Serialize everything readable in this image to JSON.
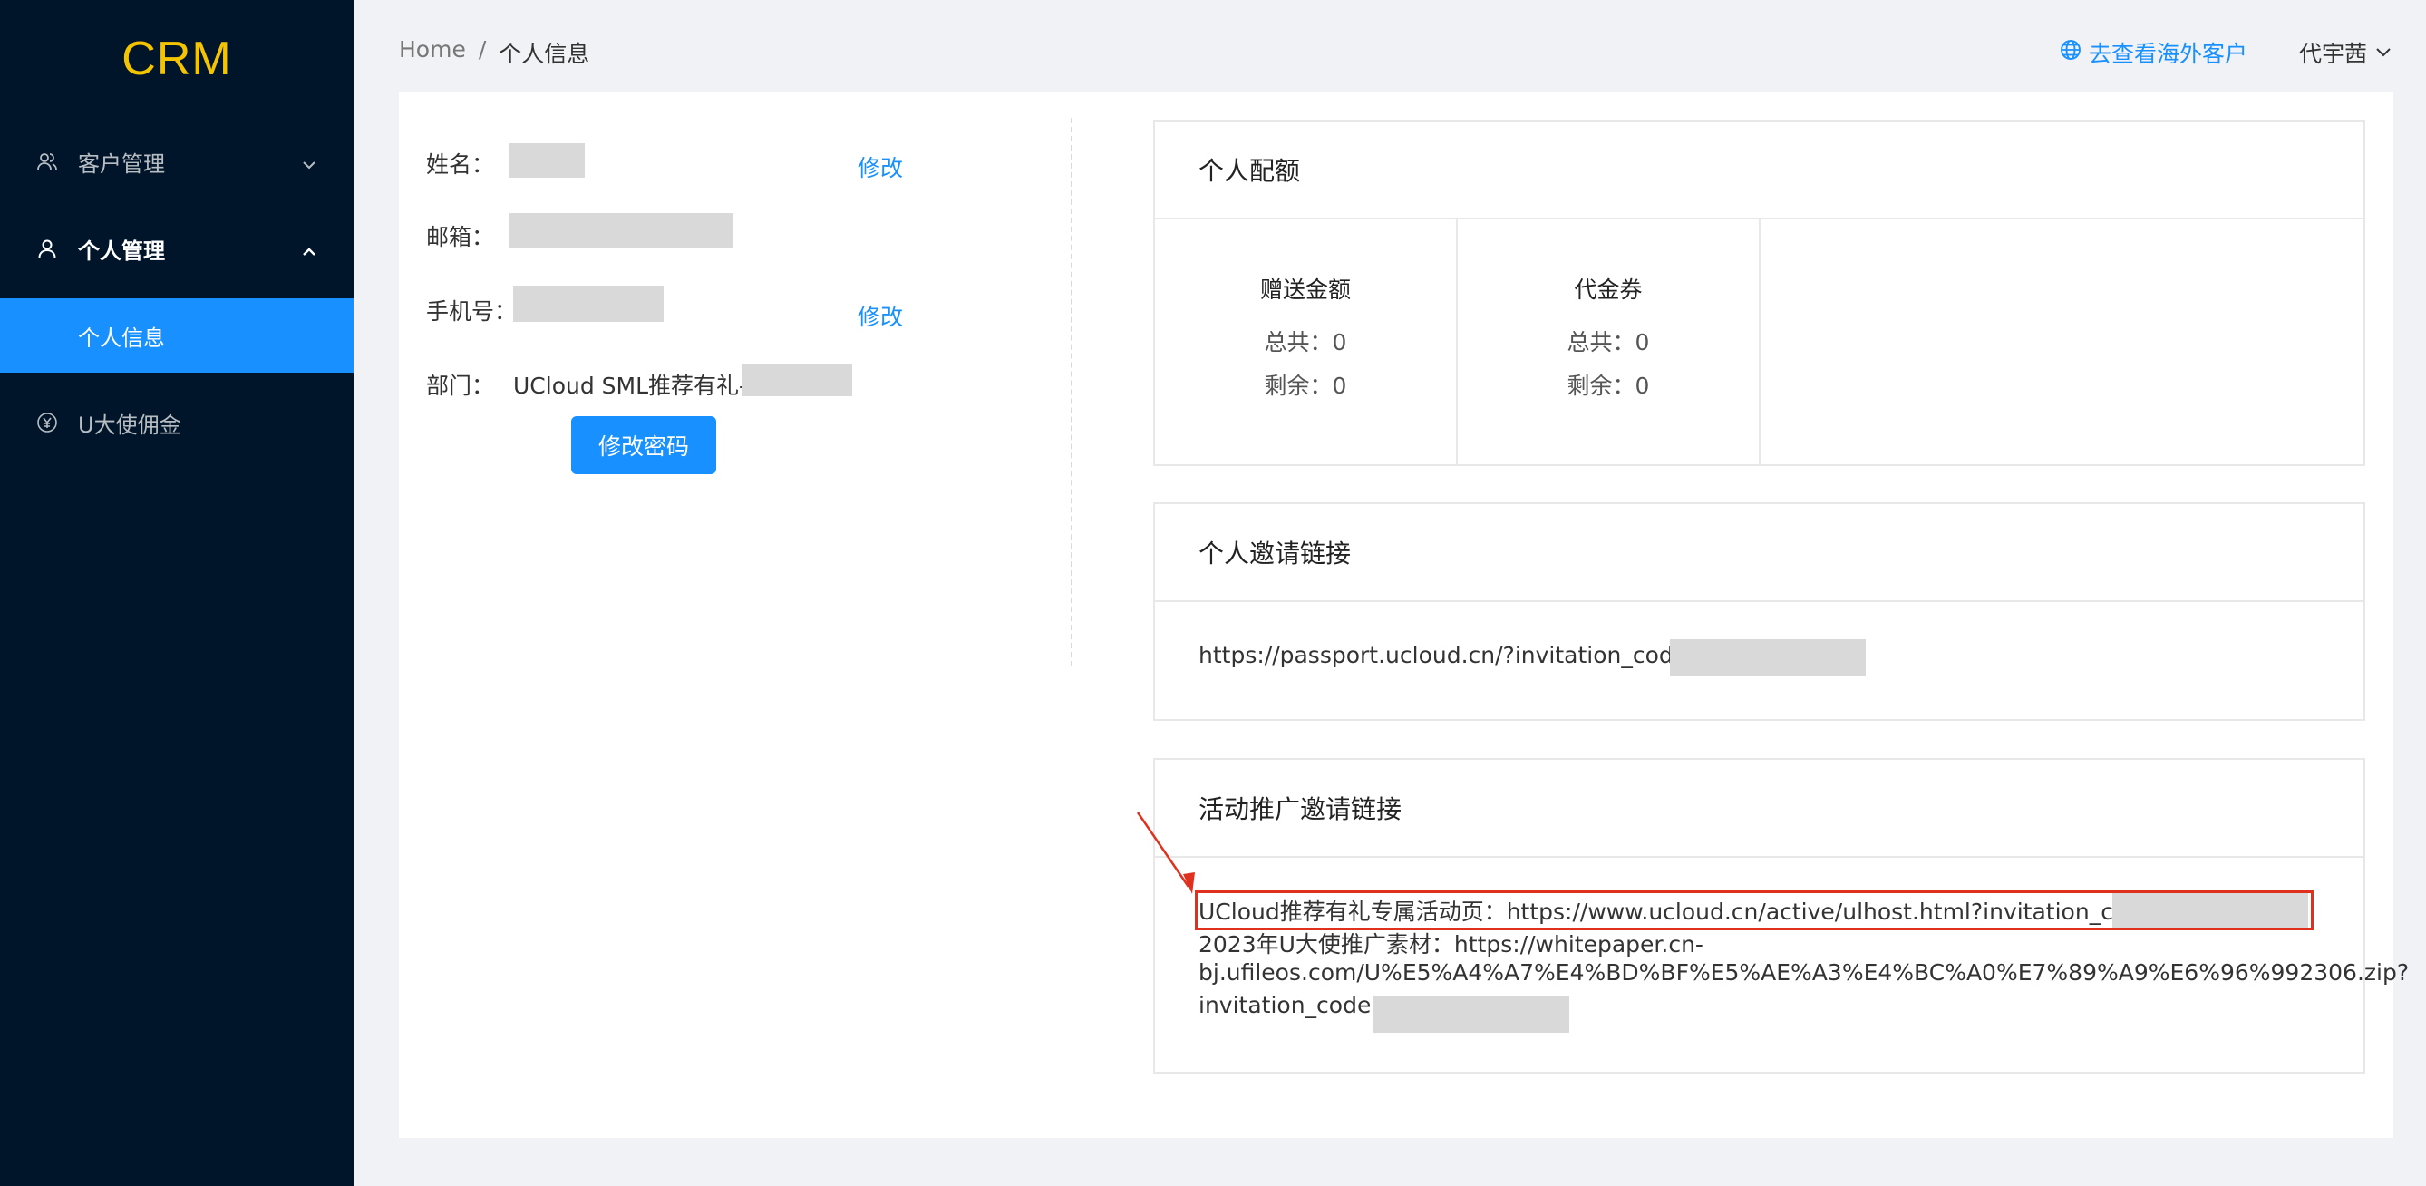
{
  "app": {
    "logo": "CRM"
  },
  "sidebar": {
    "items": [
      {
        "label": "客户管理",
        "icon": "users-icon",
        "state": "collapsed"
      },
      {
        "label": "个人管理",
        "icon": "user-icon",
        "state": "expanded"
      },
      {
        "label": "个人信息",
        "state": "selected"
      },
      {
        "label": "U大使佣金",
        "icon": "yen-circle-icon"
      }
    ]
  },
  "header": {
    "breadcrumb": {
      "home": "Home",
      "separator": "/",
      "current": "个人信息"
    },
    "overseas_link": "去查看海外客户",
    "user_name": "代宇茜"
  },
  "profile": {
    "name_label": "姓名：",
    "email_label": "邮箱：",
    "phone_label": "手机号：",
    "dept_label": "部门：",
    "dept_value": "UCloud SML推荐有礼-",
    "edit_label": "修改",
    "change_password": "修改密码"
  },
  "quota": {
    "title": "个人配额",
    "columns": [
      {
        "title": "赠送金额",
        "total": "总共：0",
        "remaining": "剩余：0"
      },
      {
        "title": "代金券",
        "total": "总共：0",
        "remaining": "剩余：0"
      }
    ]
  },
  "invite": {
    "title": "个人邀请链接",
    "url": "https://passport.ucloud.cn/?invitation_code="
  },
  "promo": {
    "title": "活动推广邀请链接",
    "line1": "UCloud推荐有礼专属活动页：https://www.ucloud.cn/active/ulhost.html?invitation_code=",
    "line2": "2023年U大使推广素材：https://whitepaper.cn-",
    "line3": "bj.ufileos.com/U%E5%A4%A7%E4%BD%BF%E5%AE%A3%E4%BC%A0%E7%89%A9%E6%96%992306.zip?",
    "line4": "invitation_code="
  },
  "colors": {
    "sidebar_bg": "#001529",
    "accent": "#1890ff",
    "logo": "#f5c400",
    "annotation": "#e0301e"
  }
}
